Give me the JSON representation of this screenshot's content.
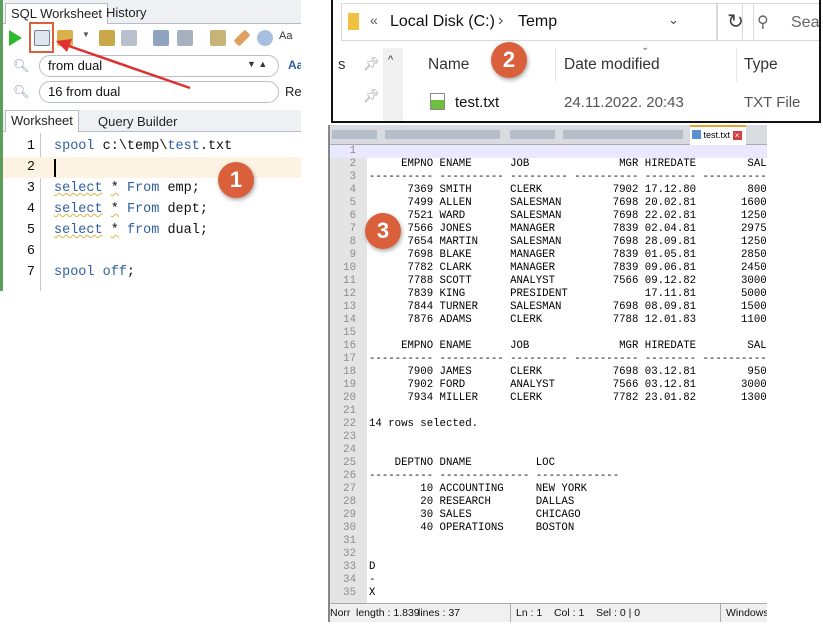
{
  "sqldev": {
    "tabs": [
      "SQL Worksheet",
      "History"
    ],
    "search": {
      "find_value": "from dual",
      "replace_value": "16 from dual",
      "match_case_label": "Aa",
      "replace_label": "Rep"
    },
    "worksheet_tabs": [
      "Worksheet",
      "Query Builder"
    ],
    "editor_lines": [
      {
        "n": "1",
        "code": "spool c:\\temp\\test.txt"
      },
      {
        "n": "2",
        "code": ""
      },
      {
        "n": "3",
        "code": "select * From emp;"
      },
      {
        "n": "4",
        "code": "select * From dept;"
      },
      {
        "n": "5",
        "code": "select * from dual;"
      },
      {
        "n": "6",
        "code": ""
      },
      {
        "n": "7",
        "code": "spool off;"
      }
    ]
  },
  "explorer": {
    "path": [
      "Local Disk (C:)",
      "Temp"
    ],
    "search_placeholder": "Sear",
    "nav_fragment": "s",
    "columns": [
      "Name",
      "Date modified",
      "Type"
    ],
    "file": {
      "name": "test.txt",
      "date": "24.11.2022. 20:43",
      "type": "TXT File"
    }
  },
  "notepad": {
    "tab": "test.txt",
    "lines": [
      "",
      "     EMPNO ENAME      JOB              MGR HIREDATE        SAL",
      "---------- ---------- --------- ---------- -------- ----------",
      "      7369 SMITH      CLERK           7902 17.12.80        800",
      "      7499 ALLEN      SALESMAN        7698 20.02.81       1600",
      "      7521 WARD       SALESMAN        7698 22.02.81       1250",
      "      7566 JONES      MANAGER         7839 02.04.81       2975",
      "      7654 MARTIN     SALESMAN        7698 28.09.81       1250",
      "      7698 BLAKE      MANAGER         7839 01.05.81       2850",
      "      7782 CLARK      MANAGER         7839 09.06.81       2450",
      "      7788 SCOTT      ANALYST         7566 09.12.82       3000",
      "      7839 KING       PRESIDENT            17.11.81       5000",
      "      7844 TURNER     SALESMAN        7698 08.09.81       1500",
      "      7876 ADAMS      CLERK           7788 12.01.83       1100",
      "",
      "     EMPNO ENAME      JOB              MGR HIREDATE        SAL",
      "---------- ---------- --------- ---------- -------- ----------",
      "      7900 JAMES      CLERK           7698 03.12.81        950",
      "      7902 FORD       ANALYST         7566 03.12.81       3000",
      "      7934 MILLER     CLERK           7782 23.01.82       1300",
      "",
      "14 rows selected.",
      "",
      "",
      "    DEPTNO DNAME          LOC",
      "---------- -------------- -------------",
      "        10 ACCOUNTING     NEW YORK",
      "        20 RESEARCH       DALLAS",
      "        30 SALES          CHICAGO",
      "        40 OPERATIONS     BOSTON",
      "",
      "",
      "D",
      "-",
      "X"
    ],
    "status": {
      "mode": "Norr",
      "length": "length : 1.839",
      "lines": "lines : 37",
      "pos": "Ln : 1    Col : 1    Sel : 0 | 0",
      "eol": "Windows"
    }
  },
  "badges": [
    "1",
    "2",
    "3"
  ],
  "colors": {
    "badge": "#d9603b",
    "arrow": "#e03030",
    "highlight_box": "#d9603b"
  }
}
